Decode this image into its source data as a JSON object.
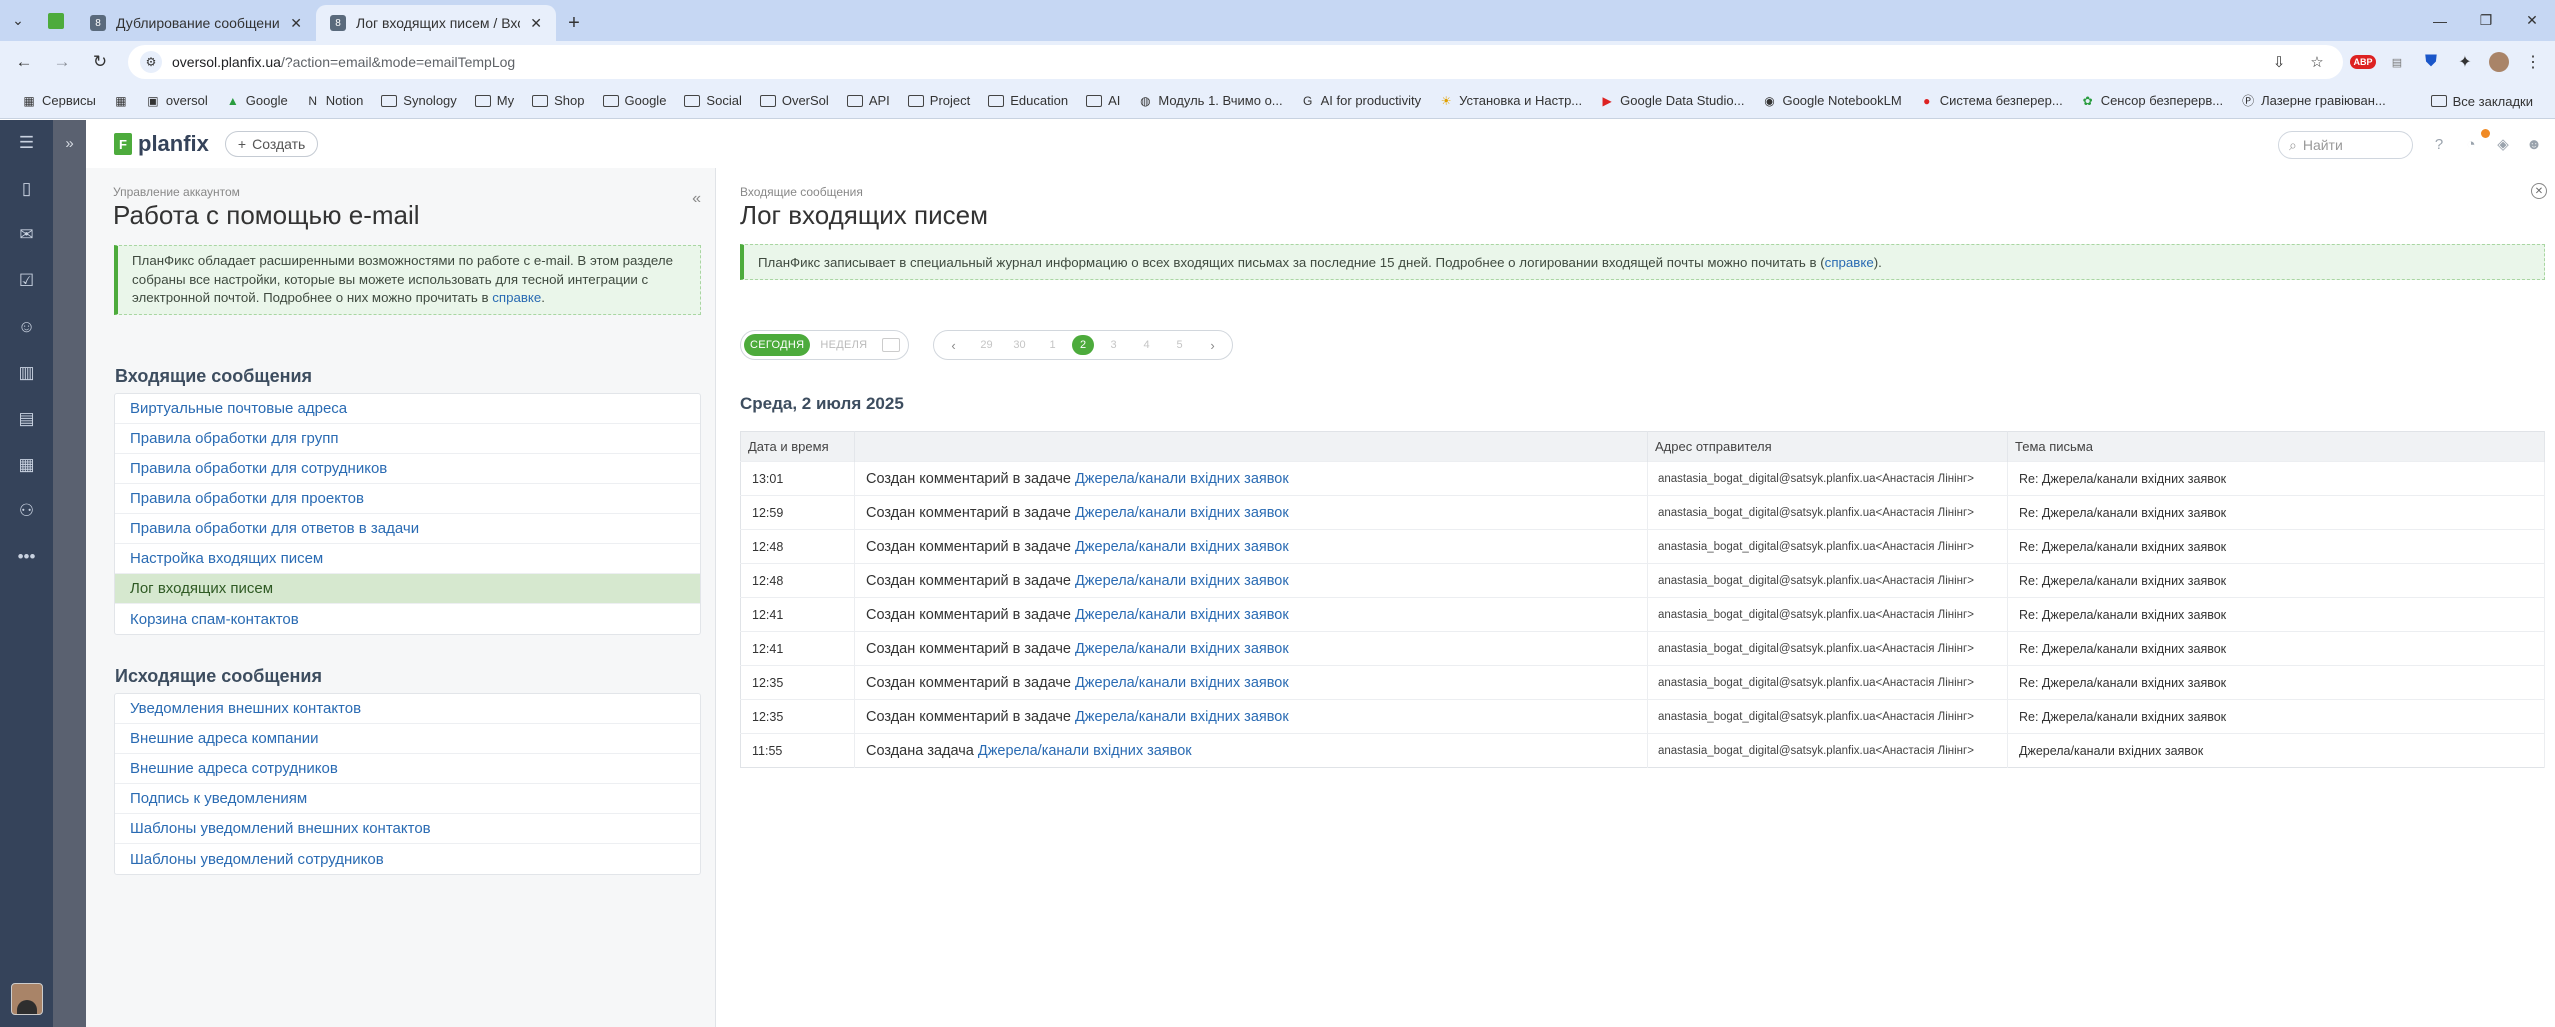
{
  "browser": {
    "tabs": [
      {
        "favicon": "8",
        "title": "Дублирование сообщений / П",
        "active": false
      },
      {
        "favicon": "8",
        "title": "Лог входящих писем / Входящ",
        "active": true
      }
    ],
    "url_host": "oversol.planfix.ua",
    "url_path": "/?action=email&mode=emailTempLog",
    "bookmarks": [
      {
        "label": "Сервисы",
        "icon": "grid-icon"
      },
      {
        "label": "",
        "icon": "apps-icon"
      },
      {
        "label": "oversol",
        "icon": "planfix-icon"
      },
      {
        "label": "Google",
        "icon": "drive-icon"
      },
      {
        "label": "Notion",
        "icon": "notion-icon"
      },
      {
        "label": "Synology",
        "icon": "folder-icon"
      },
      {
        "label": "My",
        "icon": "folder-icon"
      },
      {
        "label": "Shop",
        "icon": "folder-icon"
      },
      {
        "label": "Google",
        "icon": "folder-icon"
      },
      {
        "label": "Social",
        "icon": "folder-icon"
      },
      {
        "label": "OverSol",
        "icon": "folder-icon"
      },
      {
        "label": "API",
        "icon": "folder-icon"
      },
      {
        "label": "Project",
        "icon": "folder-icon"
      },
      {
        "label": "Education",
        "icon": "folder-icon"
      },
      {
        "label": "AI",
        "icon": "folder-icon"
      },
      {
        "label": "Модуль 1. Вчимо о...",
        "icon": "globe-icon"
      },
      {
        "label": "AI for productivity",
        "icon": "google-icon"
      },
      {
        "label": "Установка и Настр...",
        "icon": "sun-icon"
      },
      {
        "label": "Google Data Studio...",
        "icon": "youtube-icon"
      },
      {
        "label": "Google NotebookLM",
        "icon": "notebook-icon"
      },
      {
        "label": "Система безперер...",
        "icon": "red-circle-icon"
      },
      {
        "label": "Сенсор безперерв...",
        "icon": "green-icon"
      },
      {
        "label": "Лазерне гравіюван...",
        "icon": "p-icon"
      }
    ],
    "all_bookmarks": "Все закладки"
  },
  "app": {
    "logo": "planfix",
    "create_label": "Создать",
    "search_placeholder": "Найти"
  },
  "left_panel": {
    "subtitle": "Управление аккаунтом",
    "title": "Работа с помощью e-mail",
    "info_text": "ПланФикс обладает расширенными возможностями по работе с e-mail. В этом разделе собраны все настройки, которые вы можете использовать для тесной интеграции с электронной почтой. Подробнее о них можно прочитать в ",
    "info_link": "справке",
    "info_end": ".",
    "incoming_title": "Входящие сообщения",
    "incoming_items": [
      "Виртуальные почтовые адреса",
      "Правила обработки для групп",
      "Правила обработки для сотрудников",
      "Правила обработки для проектов",
      "Правила обработки для ответов в задачи",
      "Настройка входящих писем",
      "Лог входящих писем",
      "Корзина спам-контактов"
    ],
    "outgoing_title": "Исходящие сообщения",
    "outgoing_items": [
      "Уведомления внешних контактов",
      "Внешние адреса компании",
      "Внешние адреса сотрудников",
      "Подпись к уведомлениям",
      "Шаблоны уведомлений внешних контактов",
      "Шаблоны уведомлений сотрудников"
    ]
  },
  "main": {
    "subtitle": "Входящие сообщения",
    "title": "Лог входящих писем",
    "info_text": "ПланФикс записывает в специальный журнал информацию о всех входящих письмах за последние 15 дней. Подробнее о логировании входящей почты можно почитать в (",
    "info_link": "справке",
    "info_end": ").",
    "period_today": "СЕГОДНЯ",
    "period_week": "НЕДЕЛЯ",
    "pages": [
      "29",
      "30",
      "1",
      "2",
      "3",
      "4",
      "5"
    ],
    "active_page": "2",
    "date_heading": "Среда, 2 июля 2025",
    "columns": [
      "Дата и время",
      "",
      "Адрес отправителя",
      "Тема письма"
    ],
    "rows": [
      {
        "time": "13:01",
        "action": "Создан комментарий в задаче ",
        "task": "Джерела/канали вхідних заявок",
        "sender": "anastasia_bogat_digital@satsyk.planfix.ua<Анастасія Лінінг>",
        "subject": "Re: Джерела/канали вхідних заявок"
      },
      {
        "time": "12:59",
        "action": "Создан комментарий в задаче ",
        "task": "Джерела/канали вхідних заявок",
        "sender": "anastasia_bogat_digital@satsyk.planfix.ua<Анастасія Лінінг>",
        "subject": "Re: Джерела/канали вхідних заявок"
      },
      {
        "time": "12:48",
        "action": "Создан комментарий в задаче ",
        "task": "Джерела/канали вхідних заявок",
        "sender": "anastasia_bogat_digital@satsyk.planfix.ua<Анастасія Лінінг>",
        "subject": "Re: Джерела/канали вхідних заявок"
      },
      {
        "time": "12:48",
        "action": "Создан комментарий в задаче ",
        "task": "Джерела/канали вхідних заявок",
        "sender": "anastasia_bogat_digital@satsyk.planfix.ua<Анастасія Лінінг>",
        "subject": "Re: Джерела/канали вхідних заявок"
      },
      {
        "time": "12:41",
        "action": "Создан комментарий в задаче ",
        "task": "Джерела/канали вхідних заявок",
        "sender": "anastasia_bogat_digital@satsyk.planfix.ua<Анастасія Лінінг>",
        "subject": "Re: Джерела/канали вхідних заявок"
      },
      {
        "time": "12:41",
        "action": "Создан комментарий в задаче ",
        "task": "Джерела/канали вхідних заявок",
        "sender": "anastasia_bogat_digital@satsyk.planfix.ua<Анастасія Лінінг>",
        "subject": "Re: Джерела/канали вхідних заявок"
      },
      {
        "time": "12:35",
        "action": "Создан комментарий в задаче ",
        "task": "Джерела/канали вхідних заявок",
        "sender": "anastasia_bogat_digital@satsyk.planfix.ua<Анастасія Лінінг>",
        "subject": "Re: Джерела/канали вхідних заявок"
      },
      {
        "time": "12:35",
        "action": "Создан комментарий в задаче ",
        "task": "Джерела/канали вхідних заявок",
        "sender": "anastasia_bogat_digital@satsyk.planfix.ua<Анастасія Лінінг>",
        "subject": "Re: Джерела/канали вхідних заявок"
      },
      {
        "time": "11:55",
        "action": "Создана задача ",
        "task": "Джерела/канали вхідних заявок",
        "sender": "anastasia_bogat_digital@satsyk.planfix.ua<Анастасія Лінінг>",
        "subject": "Джерела/канали вхідних заявок"
      }
    ]
  },
  "colors": {
    "accent_green": "#4dab3c",
    "rail": "#35435a",
    "link": "#2a6bb3"
  }
}
